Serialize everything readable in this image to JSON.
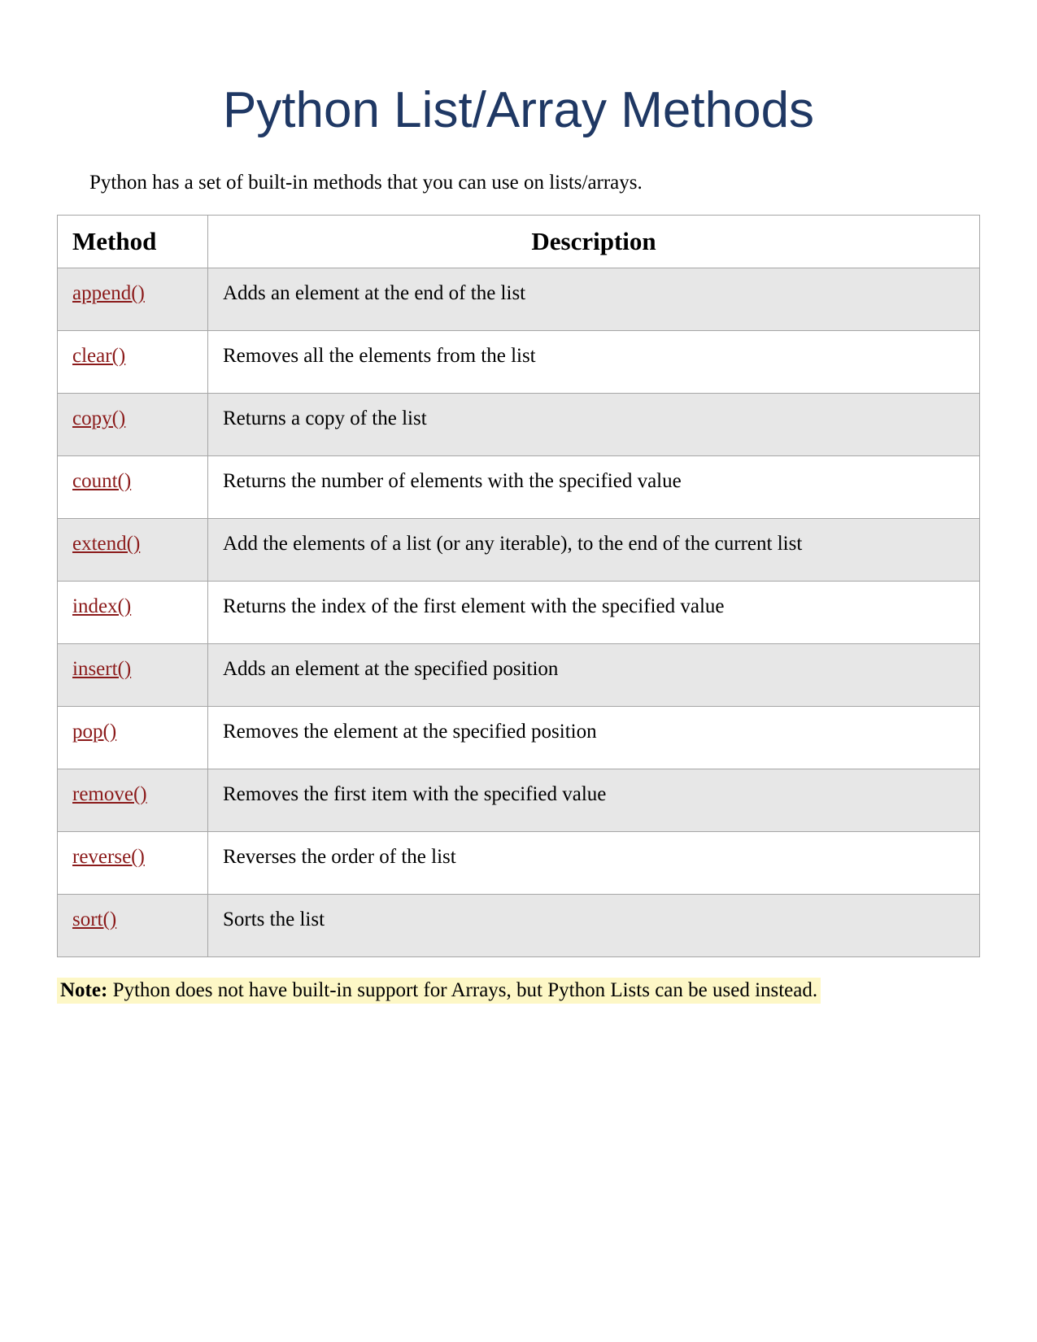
{
  "title": "Python List/Array Methods",
  "intro": "Python has a set of built-in methods that you can use on lists/arrays.",
  "table": {
    "headers": {
      "method": "Method",
      "description": "Description"
    },
    "rows": [
      {
        "method": "append()",
        "description": "Adds an element at the end of the list"
      },
      {
        "method": "clear()",
        "description": "Removes all the elements from the list"
      },
      {
        "method": "copy()",
        "description": "Returns a copy of the list"
      },
      {
        "method": "count()",
        "description": "Returns the number of elements with the specified value"
      },
      {
        "method": "extend()",
        "description": "Add the elements of a list (or any iterable), to the end of the current list"
      },
      {
        "method": "index()",
        "description": "Returns the index of the first element with the specified value"
      },
      {
        "method": "insert()",
        "description": "Adds an element at the specified position"
      },
      {
        "method": "pop()",
        "description": "Removes the element at the specified position"
      },
      {
        "method": "remove()",
        "description": "Removes the first item with the specified value"
      },
      {
        "method": "reverse()",
        "description": "Reverses the order of the list"
      },
      {
        "method": "sort()",
        "description": "Sorts the list"
      }
    ]
  },
  "note": {
    "label": "Note:",
    "text": " Python does not have built-in support for Arrays, but Python Lists can be used instead."
  }
}
